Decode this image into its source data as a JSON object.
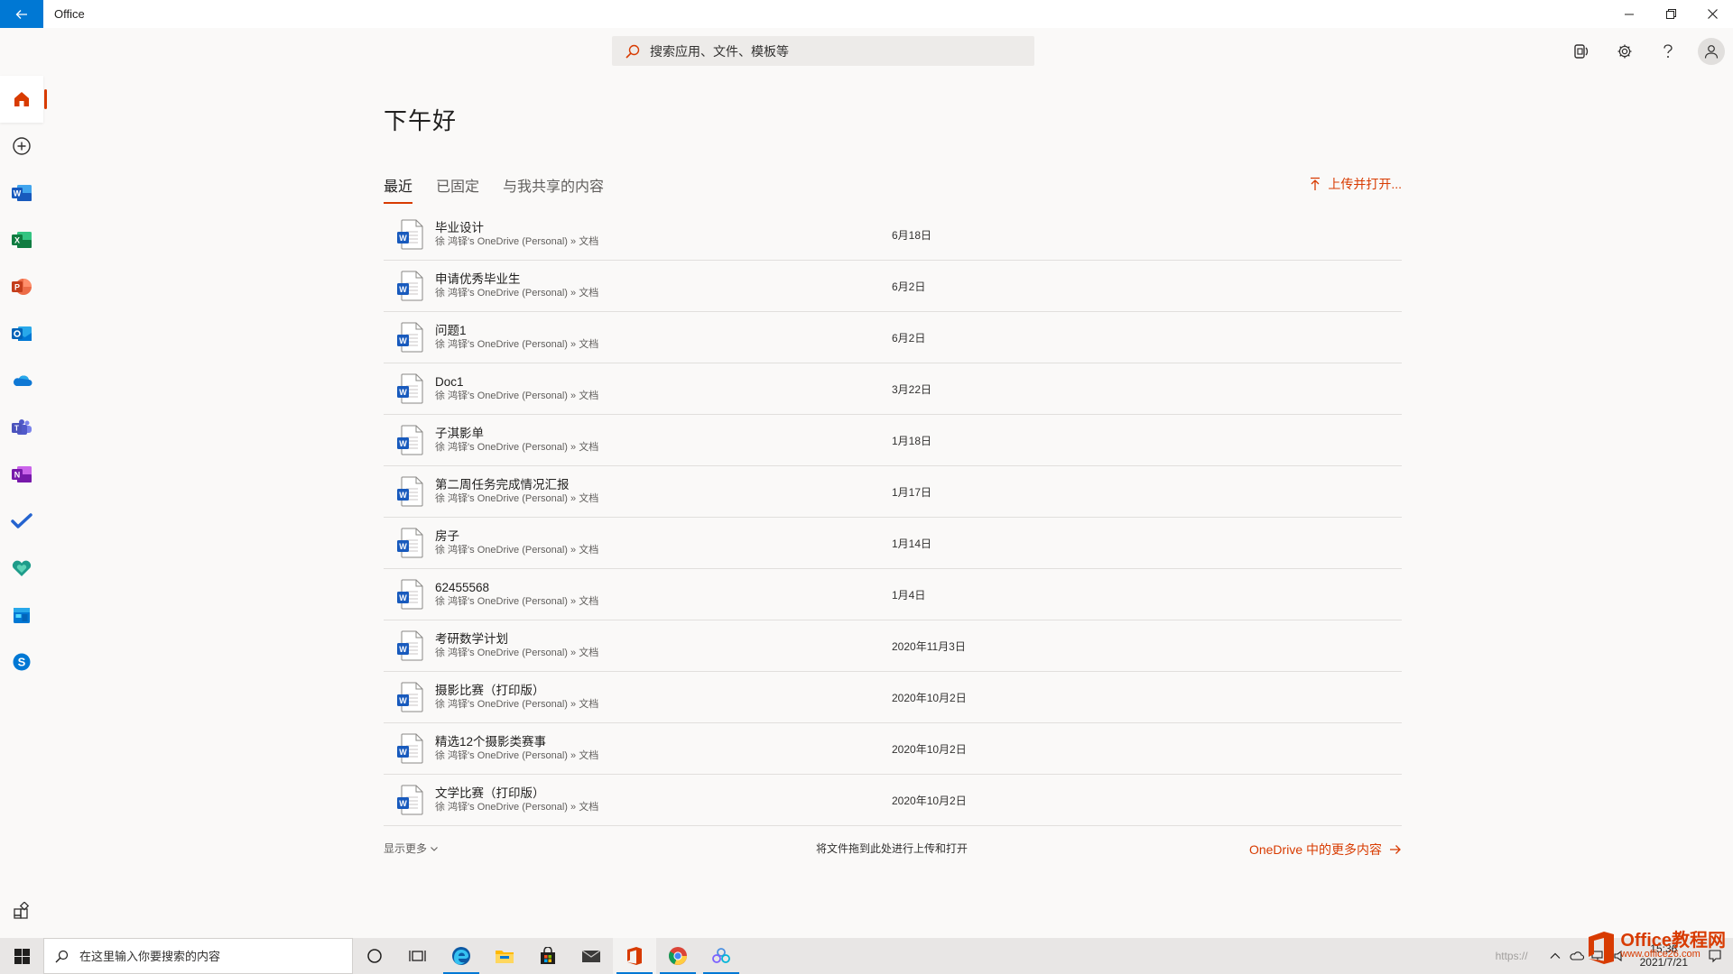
{
  "titlebar": {
    "app_title": "Office"
  },
  "search": {
    "placeholder": "搜索应用、文件、模板等"
  },
  "greeting": "下午好",
  "tabs": [
    {
      "label": "最近",
      "active": true
    },
    {
      "label": "已固定",
      "active": false
    },
    {
      "label": "与我共享的内容",
      "active": false
    }
  ],
  "upload_label": "上传并打开...",
  "files": [
    {
      "name": "毕业设计",
      "path": "徐 鸿铎's OneDrive (Personal) » 文档",
      "date": "6月18日"
    },
    {
      "name": "申请优秀毕业生",
      "path": "徐 鸿铎's OneDrive (Personal) » 文档",
      "date": "6月2日"
    },
    {
      "name": "问题1",
      "path": "徐 鸿铎's OneDrive (Personal) » 文档",
      "date": "6月2日"
    },
    {
      "name": "Doc1",
      "path": "徐 鸿铎's OneDrive (Personal) » 文档",
      "date": "3月22日"
    },
    {
      "name": "子淇影单",
      "path": "徐 鸿铎's OneDrive (Personal) » 文档",
      "date": "1月18日"
    },
    {
      "name": "第二周任务完成情况汇报",
      "path": "徐 鸿铎's OneDrive (Personal) » 文档",
      "date": "1月17日"
    },
    {
      "name": "房子",
      "path": "徐 鸿铎's OneDrive (Personal) » 文档",
      "date": "1月14日"
    },
    {
      "name": "62455568",
      "path": "徐 鸿铎's OneDrive (Personal) » 文档",
      "date": "1月4日"
    },
    {
      "name": "考研数学计划",
      "path": "徐 鸿铎's OneDrive (Personal) » 文档",
      "date": "2020年11月3日"
    },
    {
      "name": "摄影比赛（打印版）",
      "path": "徐 鸿铎's OneDrive (Personal) » 文档",
      "date": "2020年10月2日"
    },
    {
      "name": "精选12个摄影类赛事",
      "path": "徐 鸿铎's OneDrive (Personal) » 文档",
      "date": "2020年10月2日"
    },
    {
      "name": "文学比赛（打印版）",
      "path": "徐 鸿铎's OneDrive (Personal) » 文档",
      "date": "2020年10月2日"
    }
  ],
  "footer": {
    "show_more": "显示更多",
    "drag_hint": "将文件拖到此处进行上传和打开",
    "more_onedrive": "OneDrive 中的更多内容"
  },
  "rail_icons": [
    "home-icon",
    "create-new-icon",
    "word-icon",
    "excel-icon",
    "powerpoint-icon",
    "outlook-icon",
    "onedrive-icon",
    "teams-icon",
    "onenote-icon",
    "todo-icon",
    "family-safety-icon",
    "calendar-icon",
    "skype-icon"
  ],
  "taskbar": {
    "search_placeholder": "在这里输入你要搜索的内容",
    "watermark": "https://",
    "time": "15:36",
    "date": "2021/7/21"
  },
  "brand": {
    "name": "Office教程网",
    "url": "www.office26.com"
  },
  "colors": {
    "accent": "#d83b01",
    "word_blue": "#185abd",
    "excel_green": "#107c41",
    "ppt_orange": "#c43e1c",
    "windows_blue": "#0078d4",
    "background": "#faf9f8"
  }
}
